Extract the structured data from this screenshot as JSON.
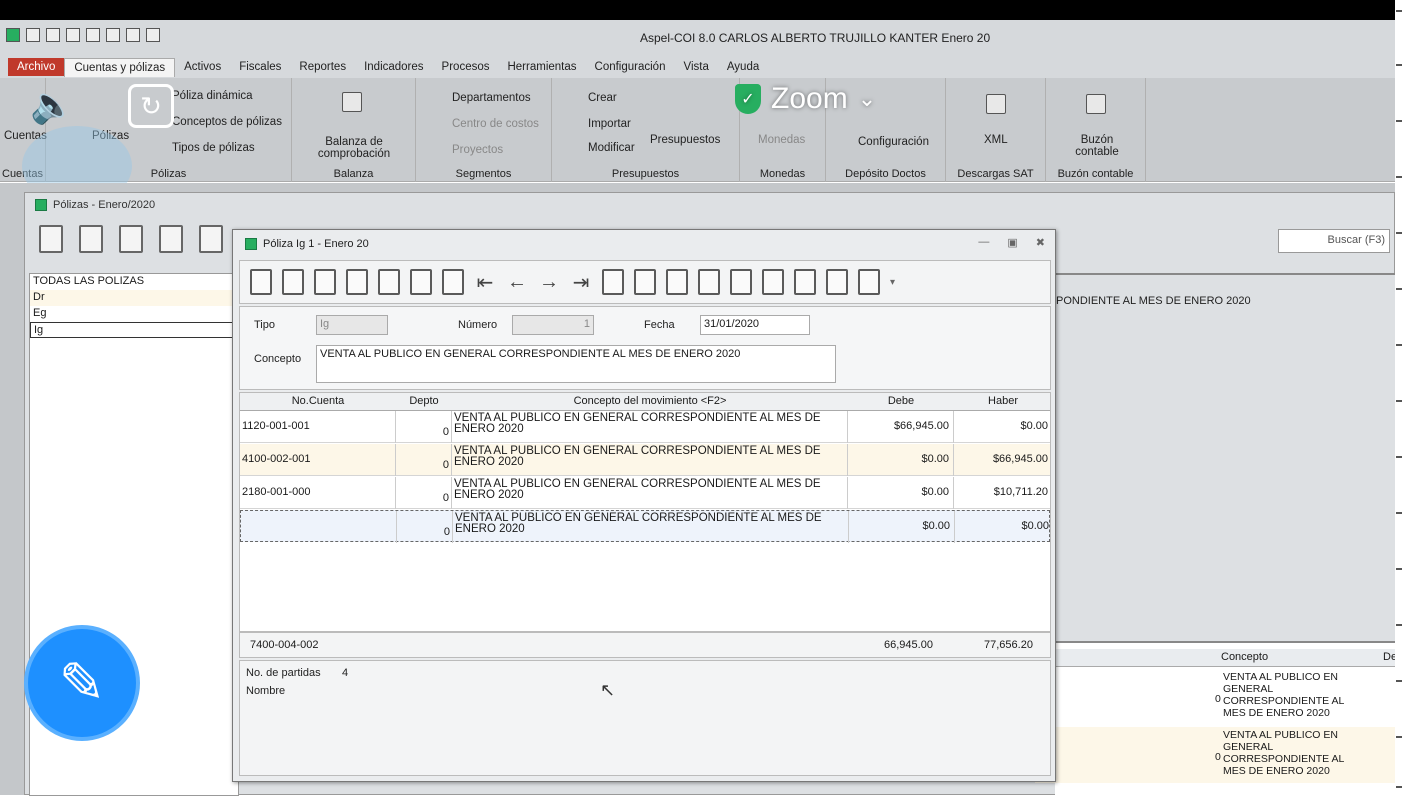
{
  "app": {
    "title": "Aspel-COI 8.0 CARLOS ALBERTO TRUJILLO KANTER Enero 20"
  },
  "menu": {
    "tabs": [
      "Archivo",
      "Cuentas y pólizas",
      "Activos",
      "Fiscales",
      "Reportes",
      "Indicadores",
      "Procesos",
      "Herramientas",
      "Configuración",
      "Vista",
      "Ayuda"
    ]
  },
  "ribbon": {
    "cuentas": {
      "label": "Cuentas",
      "group": "Cuentas"
    },
    "polizas": {
      "label": "Pólizas",
      "group": "Pólizas",
      "items": [
        "Póliza dinámica",
        "Conceptos de pólizas",
        "Tipos de pólizas"
      ]
    },
    "balanza": {
      "label": "Balanza de comprobación",
      "group": "Balanza"
    },
    "segmentos": {
      "group": "Segmentos",
      "items": [
        "Departamentos",
        "Centro de costos",
        "Proyectos"
      ]
    },
    "presupuestos": {
      "group": "Presupuestos",
      "items": [
        "Crear",
        "Importar",
        "Modificar"
      ],
      "big": "Presupuestos"
    },
    "monedas": {
      "label": "Monedas",
      "group": "Monedas"
    },
    "deposito": {
      "group": "Depósito Doctos",
      "item": "Configuración"
    },
    "descargas": {
      "label": "XML",
      "group": "Descargas SAT"
    },
    "buzon": {
      "label": "Buzón contable",
      "group": "Buzón contable"
    }
  },
  "zoom": {
    "label": "Zoom",
    "color": "#27ae60"
  },
  "polizas_win": {
    "title": "Pólizas - Enero/2020",
    "search_placeholder": "Buscar (F3)",
    "list": [
      "TODAS LAS POLIZAS",
      "Dr",
      "Eg",
      "Ig"
    ],
    "right_concept": "PONDIENTE AL  MES DE ENERO 2020",
    "bottom_header": [
      "Concepto",
      "De"
    ],
    "bottom_rows": [
      {
        "zero": "0",
        "text": "VENTA AL PUBLICO EN GENERAL CORRESPONDIENTE AL MES DE ENERO 2020"
      },
      {
        "zero": "0",
        "text": "VENTA AL PUBLICO EN GENERAL CORRESPONDIENTE AL MES DE ENERO 2020"
      }
    ]
  },
  "dialog": {
    "title": "Póliza Ig   1 - Enero 20",
    "tipo_label": "Tipo",
    "tipo_value": "Ig",
    "numero_label": "Número",
    "numero_value": "1",
    "fecha_label": "Fecha",
    "fecha_value": "31/01/2020",
    "concepto_label": "Concepto",
    "concepto_value": "VENTA AL PUBLICO EN GENERAL CORRESPONDIENTE AL  MES DE ENERO 2020",
    "columns": [
      "No.Cuenta",
      "Depto",
      "Concepto del movimiento <F2>",
      "Debe",
      "Haber"
    ],
    "rows": [
      {
        "cuenta": "1120-001-001",
        "depto": "0",
        "concepto": "VENTA AL PUBLICO EN GENERAL CORRESPONDIENTE AL  MES DE ENERO 2020",
        "debe": "$66,945.00",
        "haber": "$0.00"
      },
      {
        "cuenta": "4100-002-001",
        "depto": "0",
        "concepto": "VENTA AL PUBLICO EN GENERAL CORRESPONDIENTE AL  MES DE ENERO 2020",
        "debe": "$0.00",
        "haber": "$66,945.00"
      },
      {
        "cuenta": "2180-001-000",
        "depto": "0",
        "concepto": "VENTA AL PUBLICO EN GENERAL CORRESPONDIENTE AL  MES DE ENERO 2020",
        "debe": "$0.00",
        "haber": "$10,711.20"
      },
      {
        "cuenta": "",
        "depto": "0",
        "concepto": "VENTA AL PUBLICO EN GENERAL CORRESPONDIENTE AL  MES DE ENERO 2020",
        "debe": "$0.00",
        "haber": "$0.00"
      }
    ],
    "totals": {
      "cuenta": "7400-004-002",
      "debe": "66,945.00",
      "haber": "77,656.20"
    },
    "partidas_label": "No. de partidas",
    "partidas_value": "4",
    "nombre_label": "Nombre"
  }
}
